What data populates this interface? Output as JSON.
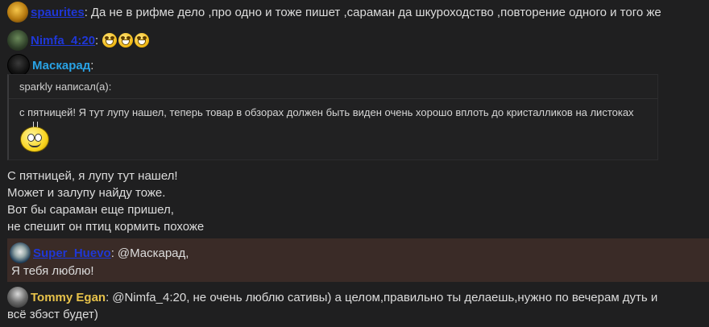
{
  "messages": {
    "m1": {
      "author": "spaurites",
      "colon": ":",
      "text": "Да не в рифме дело ,про одно и тоже пишет ,сараман да шкуроходство ,повторение одного и того же"
    },
    "m2": {
      "author": "Nimfa_4:20",
      "colon": ":",
      "smiley_count": 3
    },
    "m3": {
      "author": "Маскарад",
      "colon": ":",
      "quote_header": "sparkly написал(а):",
      "quote_text": "с пятницей! Я тут лупу нашел, теперь товар в обзорах должен быть виден очень хорошо вплоть до кристалликов на листоках",
      "lines": [
        "С пятницей, я лупу тут нашел!",
        "Может и залупу найду тоже.",
        "Вот бы сараман еще пришел,",
        "не спешит он птиц кормить похоже"
      ]
    },
    "m4": {
      "author": "Super_Huevo",
      "colon": ":",
      "mention": "@Маскарад",
      "comma": ",",
      "text": "Я тебя люблю!"
    },
    "m5": {
      "author": "Tommy Egan",
      "colon": ":",
      "mention": "@Nimfa_4:20",
      "text": ", не очень люблю сативы) а целом,правильно ты делаешь,нужно по вечерам дуть и",
      "text2": "всё збэст будет)"
    }
  },
  "colors": {
    "background": "#1f1f20",
    "link_blue": "#1f37d6",
    "moderator_blue": "#29a3e6",
    "gold_user": "#e7c24a",
    "reply_highlight": "#3a2b27"
  }
}
